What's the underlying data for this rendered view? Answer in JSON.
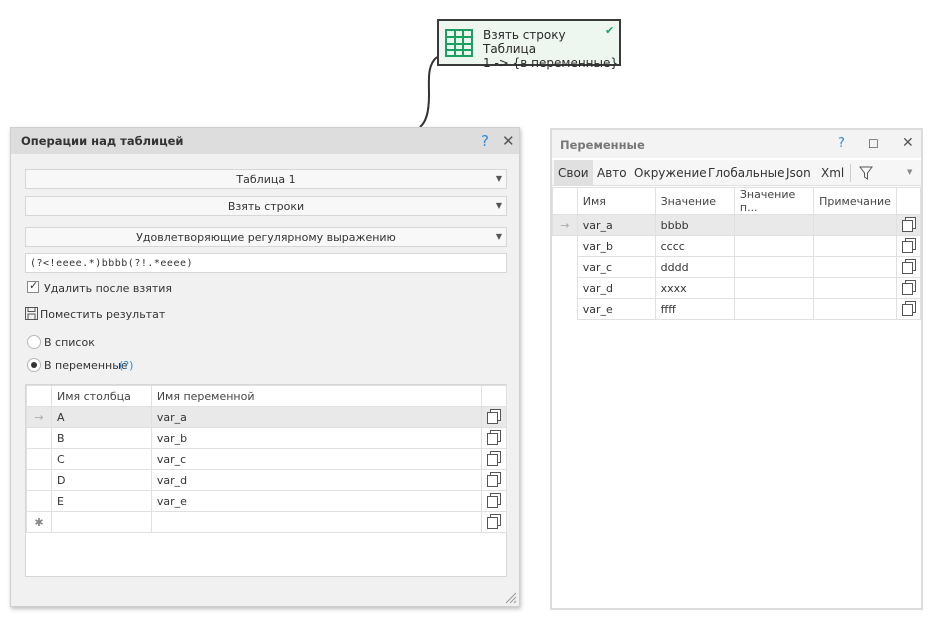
{
  "node": {
    "line1": "Взять строку Таблица",
    "line2": "1 -> {в переменные}"
  },
  "dialog": {
    "title": "Операции над таблицей",
    "help": "?",
    "close": "✕",
    "table_select": "Таблица 1",
    "action_select": "Взять строки",
    "mode_select": "Удовлетворяющие регулярному выражению",
    "regex_value": "(?<!eeee.*)bbbb(?!.*eeee)",
    "delete_after_label": "Удалить после взятия",
    "place_result_label": "Поместить результат",
    "radio_list_label": "В список",
    "radio_vars_label": "В переменные",
    "radio_vars_help": "(?)",
    "grid": {
      "headers": [
        "Имя столбца",
        "Имя переменной"
      ],
      "rows": [
        {
          "col": "A",
          "var": "var_a"
        },
        {
          "col": "B",
          "var": "var_b"
        },
        {
          "col": "C",
          "var": "var_c"
        },
        {
          "col": "D",
          "var": "var_d"
        },
        {
          "col": "E",
          "var": "var_e"
        }
      ],
      "new_row_marker": "✱"
    }
  },
  "vars_panel": {
    "title": "Переменные",
    "help": "?",
    "maximize": "☐",
    "close": "✕",
    "tabs": [
      "Свои",
      "Авто",
      "Окружение",
      "Глобальные",
      "Json",
      "Xml"
    ],
    "headers": [
      "Имя",
      "Значение",
      "Значение п...",
      "Примечание"
    ],
    "rows": [
      {
        "name": "var_a",
        "value": "bbbb"
      },
      {
        "name": "var_b",
        "value": "cccc"
      },
      {
        "name": "var_c",
        "value": "dddd"
      },
      {
        "name": "var_d",
        "value": "xxxx"
      },
      {
        "name": "var_e",
        "value": "ffff"
      }
    ]
  },
  "colors": {
    "accent_blue": "#2e8bd6",
    "node_green": "#1aa060",
    "node_bg": "#eef6f0"
  }
}
